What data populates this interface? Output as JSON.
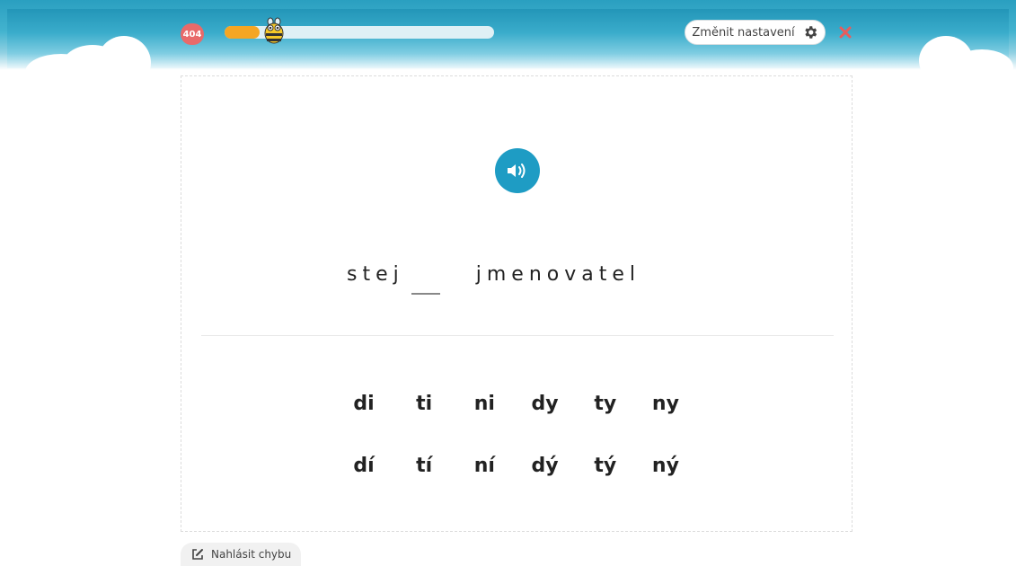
{
  "header": {
    "score": "404",
    "progress_fraction": 0.13,
    "settings_label": "Změnit nastavení",
    "colors": {
      "progress": "#f5a623",
      "badge": "#e86a6a",
      "close": "#e85c5c"
    }
  },
  "exercise": {
    "audio_icon": "speaker-icon",
    "sentence_before": "stej",
    "sentence_after": "jmenovatel",
    "options_row1": [
      "di",
      "ti",
      "ni",
      "dy",
      "ty",
      "ny"
    ],
    "options_row2": [
      "dí",
      "tí",
      "ní",
      "dý",
      "tý",
      "ný"
    ]
  },
  "footer": {
    "report_label": "Nahlásit chybu"
  }
}
